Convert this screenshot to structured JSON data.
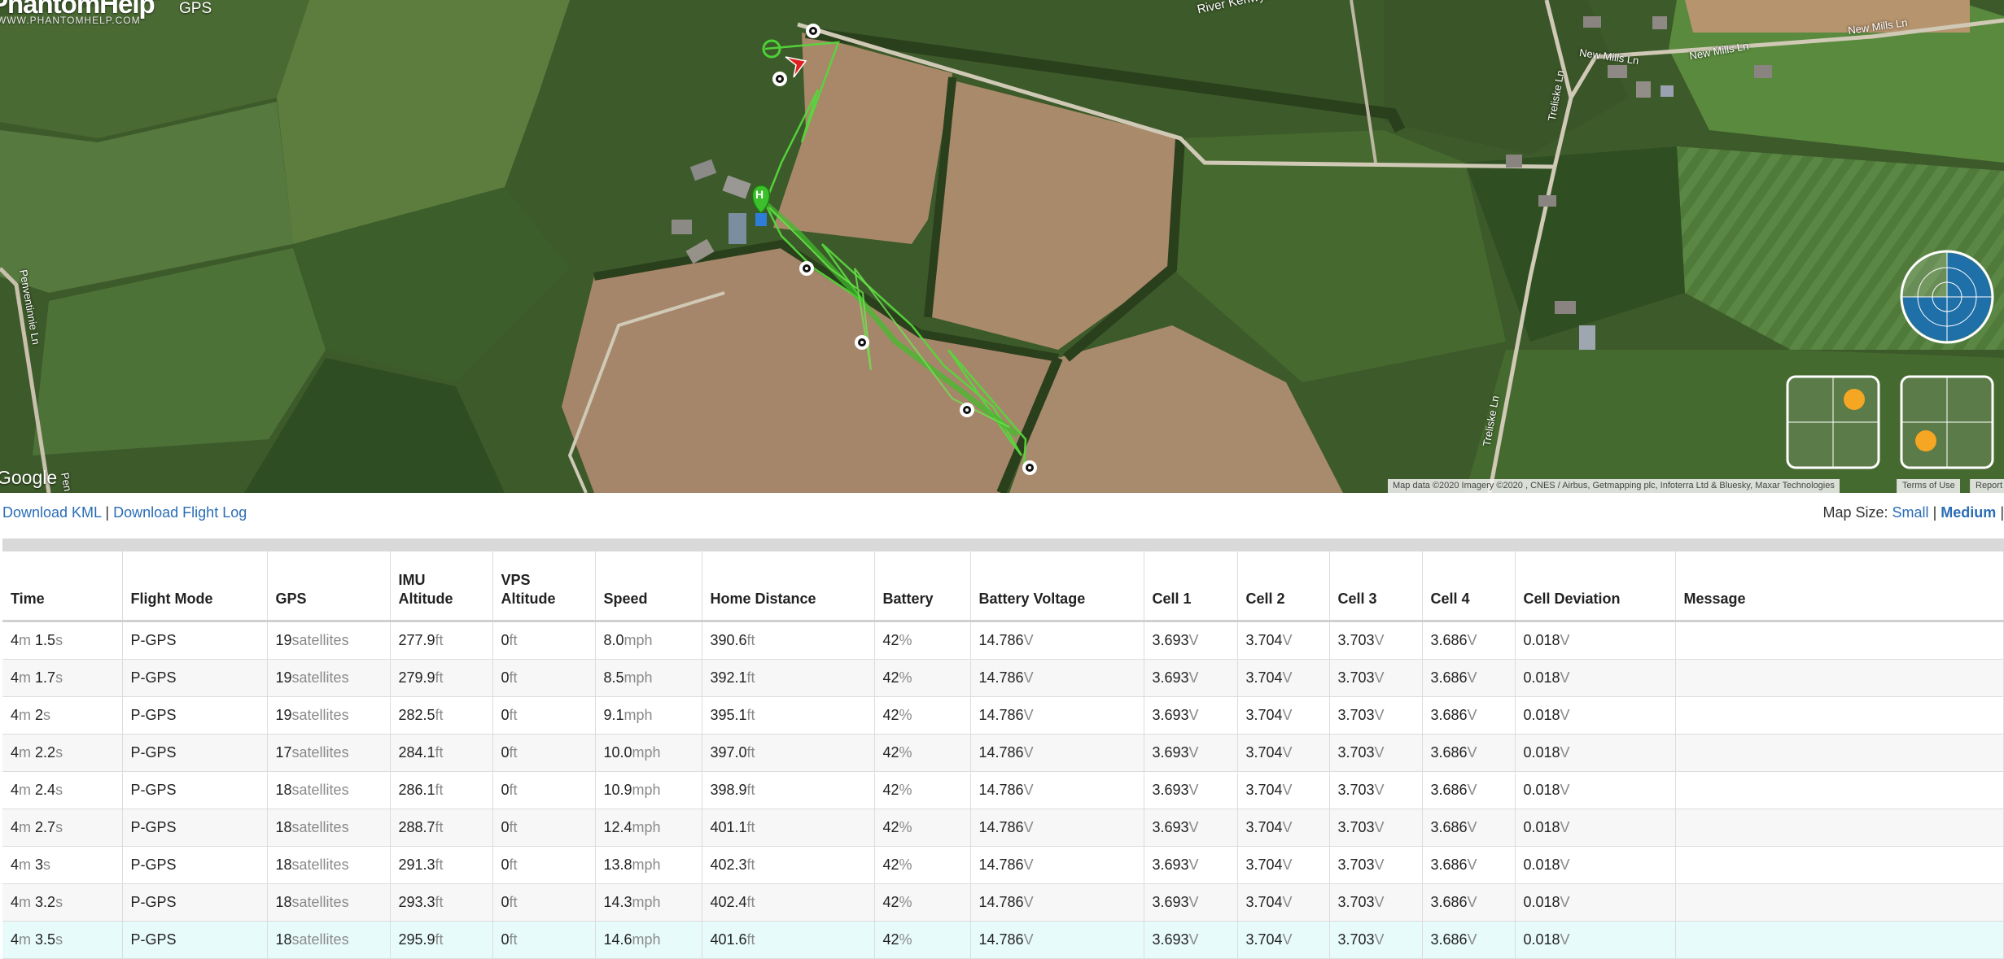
{
  "header": {
    "brand": "PhantomHelp",
    "brand_sub": "WWW.PHANTOMHELP.COM",
    "gps_label": "GPS"
  },
  "map": {
    "google_logo": "Google",
    "attribution": "Map data ©2020 Imagery ©2020 , CNES / Airbus, Getmapping plc, Infoterra Ltd & Bluesky, Maxar Technologies",
    "terms": "Terms of Use",
    "report": "Report",
    "road_labels": {
      "river": "River Kenwyn",
      "new_mills_1": "New Mills Ln",
      "new_mills_2": "New Mills Ln",
      "new_mills_3": "New Mills Ln",
      "treliske_1": "Treliske Ln",
      "treliske_2": "Treliske Ln",
      "penventinnie": "Penventinnie Ln",
      "pen": "Pen"
    },
    "home_marker": "H",
    "colors": {
      "path": "#4cd137",
      "marker_border": "#ffffff",
      "aircraft": "#e02020",
      "gauge_dot": "#f5a623",
      "compass": "#1f6fa8"
    }
  },
  "links": {
    "download_kml": "Download KML",
    "separator": "|",
    "download_log": "Download Flight Log",
    "map_size_label": "Map Size:",
    "size_small": "Small",
    "size_medium": "Medium"
  },
  "table": {
    "headers": {
      "time": "Time",
      "flight_mode": "Flight Mode",
      "gps": "GPS",
      "imu_alt_1": "IMU",
      "imu_alt_2": "Altitude",
      "vps_alt_1": "VPS",
      "vps_alt_2": "Altitude",
      "speed": "Speed",
      "home_distance": "Home Distance",
      "battery": "Battery",
      "battery_voltage": "Battery Voltage",
      "cell1": "Cell 1",
      "cell2": "Cell 2",
      "cell3": "Cell 3",
      "cell4": "Cell 4",
      "cell_dev": "Cell Deviation",
      "message": "Message"
    },
    "units": {
      "min": "m",
      "sec": "s",
      "sat": "satellites",
      "ft": "ft",
      "mph": "mph",
      "pct": "%",
      "v": "V"
    },
    "rows": [
      {
        "m": "4",
        "s": "1.5",
        "mode": "P-GPS",
        "sats": "19",
        "imu": "277.9",
        "vps": "0",
        "speed": "8.0",
        "home": "390.6",
        "batt": "42",
        "bv": "14.786",
        "c1": "3.693",
        "c2": "3.704",
        "c3": "3.703",
        "c4": "3.686",
        "dev": "0.018",
        "msg": ""
      },
      {
        "m": "4",
        "s": "1.7",
        "mode": "P-GPS",
        "sats": "19",
        "imu": "279.9",
        "vps": "0",
        "speed": "8.5",
        "home": "392.1",
        "batt": "42",
        "bv": "14.786",
        "c1": "3.693",
        "c2": "3.704",
        "c3": "3.703",
        "c4": "3.686",
        "dev": "0.018",
        "msg": ""
      },
      {
        "m": "4",
        "s": "2",
        "mode": "P-GPS",
        "sats": "19",
        "imu": "282.5",
        "vps": "0",
        "speed": "9.1",
        "home": "395.1",
        "batt": "42",
        "bv": "14.786",
        "c1": "3.693",
        "c2": "3.704",
        "c3": "3.703",
        "c4": "3.686",
        "dev": "0.018",
        "msg": ""
      },
      {
        "m": "4",
        "s": "2.2",
        "mode": "P-GPS",
        "sats": "17",
        "imu": "284.1",
        "vps": "0",
        "speed": "10.0",
        "home": "397.0",
        "batt": "42",
        "bv": "14.786",
        "c1": "3.693",
        "c2": "3.704",
        "c3": "3.703",
        "c4": "3.686",
        "dev": "0.018",
        "msg": ""
      },
      {
        "m": "4",
        "s": "2.4",
        "mode": "P-GPS",
        "sats": "18",
        "imu": "286.1",
        "vps": "0",
        "speed": "10.9",
        "home": "398.9",
        "batt": "42",
        "bv": "14.786",
        "c1": "3.693",
        "c2": "3.704",
        "c3": "3.703",
        "c4": "3.686",
        "dev": "0.018",
        "msg": ""
      },
      {
        "m": "4",
        "s": "2.7",
        "mode": "P-GPS",
        "sats": "18",
        "imu": "288.7",
        "vps": "0",
        "speed": "12.4",
        "home": "401.1",
        "batt": "42",
        "bv": "14.786",
        "c1": "3.693",
        "c2": "3.704",
        "c3": "3.703",
        "c4": "3.686",
        "dev": "0.018",
        "msg": ""
      },
      {
        "m": "4",
        "s": "3",
        "mode": "P-GPS",
        "sats": "18",
        "imu": "291.3",
        "vps": "0",
        "speed": "13.8",
        "home": "402.3",
        "batt": "42",
        "bv": "14.786",
        "c1": "3.693",
        "c2": "3.704",
        "c3": "3.703",
        "c4": "3.686",
        "dev": "0.018",
        "msg": ""
      },
      {
        "m": "4",
        "s": "3.2",
        "mode": "P-GPS",
        "sats": "18",
        "imu": "293.3",
        "vps": "0",
        "speed": "14.3",
        "home": "402.4",
        "batt": "42",
        "bv": "14.786",
        "c1": "3.693",
        "c2": "3.704",
        "c3": "3.703",
        "c4": "3.686",
        "dev": "0.018",
        "msg": ""
      },
      {
        "m": "4",
        "s": "3.5",
        "mode": "P-GPS",
        "sats": "18",
        "imu": "295.9",
        "vps": "0",
        "speed": "14.6",
        "home": "401.6",
        "batt": "42",
        "bv": "14.786",
        "c1": "3.693",
        "c2": "3.704",
        "c3": "3.703",
        "c4": "3.686",
        "dev": "0.018",
        "msg": "",
        "highlight": true
      }
    ]
  }
}
